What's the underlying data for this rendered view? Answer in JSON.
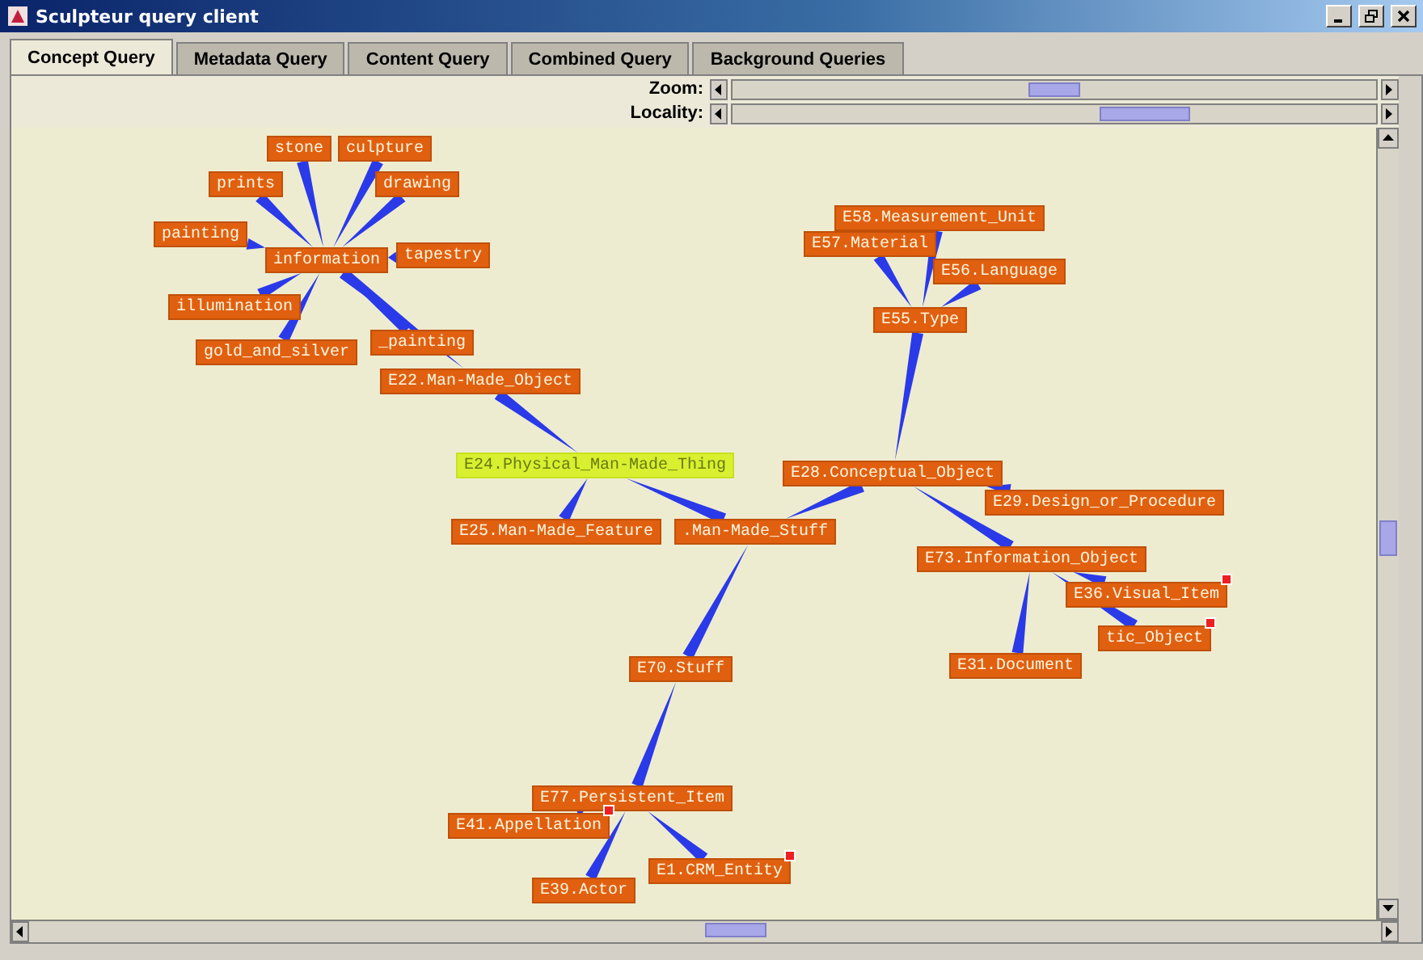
{
  "window": {
    "title": "Sculpteur query client"
  },
  "tabs": [
    {
      "label": "Concept Query",
      "selected": true
    },
    {
      "label": "Metadata Query",
      "selected": false
    },
    {
      "label": "Content Query",
      "selected": false
    },
    {
      "label": "Combined Query",
      "selected": false
    },
    {
      "label": "Background Queries",
      "selected": false
    }
  ],
  "sliders": [
    {
      "label": "Zoom:",
      "level": 0.5
    },
    {
      "label": "Locality:",
      "level": 0.64
    }
  ],
  "graph": {
    "root": {
      "label": "E24.Physical_Man-Made_Thing",
      "selected": true,
      "flag": false,
      "children": [
        {
          "label": "E22.Man-Made_Object",
          "selected": false,
          "flag": false,
          "children": [
            {
              "label": "information",
              "selected": false,
              "flag": false,
              "children": [
                {
                  "label": "stone",
                  "selected": false,
                  "flag": false
                },
                {
                  "label": "culpture",
                  "selected": false,
                  "flag": false
                },
                {
                  "label": "prints",
                  "selected": false,
                  "flag": false
                },
                {
                  "label": "drawing",
                  "selected": false,
                  "flag": false
                },
                {
                  "label": "painting",
                  "selected": false,
                  "flag": false
                },
                {
                  "label": "tapestry",
                  "selected": false,
                  "flag": false
                },
                {
                  "label": "illumination",
                  "selected": false,
                  "flag": false
                },
                {
                  "label": "gold_and_silver",
                  "selected": false,
                  "flag": false
                },
                {
                  "label": "_painting",
                  "selected": false,
                  "flag": false
                }
              ]
            }
          ]
        },
        {
          "label": "E25.Man-Made_Feature",
          "selected": false,
          "flag": false
        },
        {
          "label": ".Man-Made_Stuff",
          "selected": false,
          "flag": false,
          "children": [
            {
              "label": "E70.Stuff",
              "selected": false,
              "flag": false,
              "children": [
                {
                  "label": "E77.Persistent_Item",
                  "selected": false,
                  "flag": false,
                  "children": [
                    {
                      "label": "E41.Appellation",
                      "selected": false,
                      "flag": true
                    },
                    {
                      "label": "E39.Actor",
                      "selected": false,
                      "flag": false
                    },
                    {
                      "label": "E1.CRM_Entity",
                      "selected": false,
                      "flag": true
                    }
                  ]
                }
              ]
            },
            {
              "label": "E28.Conceptual_Object",
              "selected": false,
              "flag": false,
              "children": [
                {
                  "label": "E55.Type",
                  "selected": false,
                  "flag": false,
                  "children": [
                    {
                      "label": "E58.Measurement_Unit",
                      "selected": false,
                      "flag": false
                    },
                    {
                      "label": "E57.Material",
                      "selected": false,
                      "flag": false
                    },
                    {
                      "label": "E56.Language",
                      "selected": false,
                      "flag": false
                    }
                  ]
                },
                {
                  "label": "E29.Design_or_Procedure",
                  "selected": false,
                  "flag": false
                },
                {
                  "label": "E73.Information_Object",
                  "selected": false,
                  "flag": false,
                  "children": [
                    {
                      "label": "E36.Visual_Item",
                      "selected": false,
                      "flag": true
                    },
                    {
                      "label": "tic_Object",
                      "selected": false,
                      "flag": true
                    },
                    {
                      "label": "E31.Document",
                      "selected": false,
                      "flag": false
                    }
                  ]
                }
              ]
            }
          ]
        }
      ]
    }
  }
}
